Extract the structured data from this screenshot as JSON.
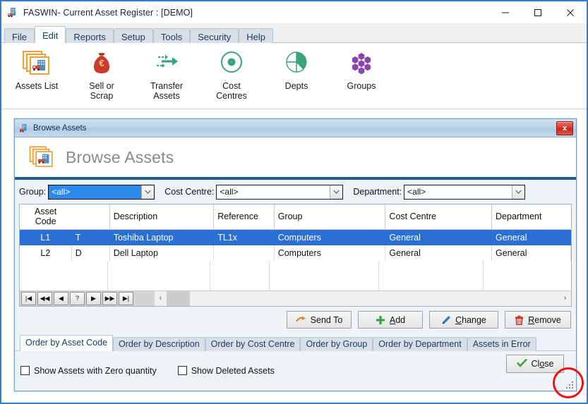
{
  "window": {
    "title": "FASWIN- Current Asset Register : [DEMO]",
    "icon": "building-icon",
    "controls": {
      "minimize": "minimize-icon",
      "maximize": "maximize-icon",
      "close": "close-icon"
    }
  },
  "menubar": {
    "items": [
      {
        "label": "File",
        "active": false
      },
      {
        "label": "Edit",
        "active": true
      },
      {
        "label": "Reports",
        "active": false
      },
      {
        "label": "Setup",
        "active": false
      },
      {
        "label": "Tools",
        "active": false
      },
      {
        "label": "Security",
        "active": false
      },
      {
        "label": "Help",
        "active": false
      }
    ]
  },
  "toolbar": {
    "buttons": [
      {
        "label": "Assets List",
        "icon": "stacked-cards-icon",
        "line1": "Assets List",
        "line2": ""
      },
      {
        "label": "Sell or Scrap",
        "icon": "money-bag-icon",
        "line1": "Sell or",
        "line2": "Scrap"
      },
      {
        "label": "Transfer Assets",
        "icon": "arrows-transfer-icon",
        "line1": "Transfer",
        "line2": "Assets"
      },
      {
        "label": "Cost Centres",
        "icon": "target-circle-icon",
        "line1": "Cost",
        "line2": "Centres"
      },
      {
        "label": "Depts",
        "icon": "pie-chart-icon",
        "line1": "Depts",
        "line2": ""
      },
      {
        "label": "Groups",
        "icon": "hexagon-cluster-icon",
        "line1": "Groups",
        "line2": ""
      }
    ]
  },
  "dialog": {
    "titlebar_text": "Browse Assets",
    "titlebar_icon": "building-icon",
    "close_glyph": "x",
    "heading": "Browse Assets",
    "heading_icon": "stacked-cards-icon",
    "filters": [
      {
        "label": "Group:",
        "value": "<all>",
        "focused": true,
        "name": "group"
      },
      {
        "label": "Cost Centre:",
        "value": "<all>",
        "focused": false,
        "name": "cost-centre"
      },
      {
        "label": "Department:",
        "value": "<all>",
        "focused": false,
        "name": "department"
      }
    ],
    "grid": {
      "columns": [
        "Asset Code",
        "",
        "Description",
        "Reference",
        "Group",
        "Cost Centre",
        "Department"
      ],
      "rows": [
        {
          "selected": true,
          "cells": [
            "L1",
            "T",
            "Toshiba Laptop",
            "TL1x",
            "Computers",
            "General",
            "General"
          ]
        },
        {
          "selected": false,
          "cells": [
            "L2",
            "D",
            "Dell Laptop",
            "",
            "Computers",
            "General",
            "General"
          ]
        }
      ]
    },
    "navigator": {
      "buttons": [
        "first",
        "prior-page",
        "prior",
        "help",
        "next",
        "next-page",
        "last"
      ],
      "glyphs": [
        "|◀",
        "◀◀",
        "◀",
        "?",
        "▶",
        "▶▶",
        "▶|"
      ]
    },
    "hscroll": {
      "left_glyph": "‹",
      "right_glyph": "›"
    },
    "actions": [
      {
        "label": "Send To",
        "icon": "send-arrow-icon",
        "accel": "",
        "pre": "Send To",
        "post": ""
      },
      {
        "label": "Add",
        "icon": "plus-icon",
        "accel": "A",
        "pre": "",
        "post": "dd"
      },
      {
        "label": "Change",
        "icon": "pencil-icon",
        "accel": "C",
        "pre": "",
        "post": "hange"
      },
      {
        "label": "Remove",
        "icon": "trash-icon",
        "accel": "R",
        "pre": "",
        "post": "emove"
      }
    ],
    "tabs": [
      {
        "label": "Order by Asset Code",
        "active": true
      },
      {
        "label": "Order by Description",
        "active": false
      },
      {
        "label": "Order by Cost Centre",
        "active": false
      },
      {
        "label": "Order by Group",
        "active": false
      },
      {
        "label": "Order by Department",
        "active": false
      },
      {
        "label": "Assets in Error",
        "active": false
      }
    ],
    "checkboxes": [
      {
        "label": "Show Assets with Zero quantity",
        "checked": false
      },
      {
        "label": "Show Deleted Assets",
        "checked": false
      }
    ],
    "close_button": {
      "pre": "Cl",
      "accel": "o",
      "post": "se",
      "icon": "green-check-icon"
    },
    "resize_grip": "resize-grip",
    "annotation": "red-circle-highlight"
  },
  "colors": {
    "window_border": "#2f7fd0",
    "selection": "#2a6fd4",
    "focus_combo": "#2a8aee",
    "dialog_rule": "#1f5c96",
    "annotation": "#ee1111",
    "accent_orange": "#e8a33d",
    "accent_green": "#3aa47c",
    "accent_purple": "#8e44ad",
    "accent_red": "#cc3322"
  }
}
